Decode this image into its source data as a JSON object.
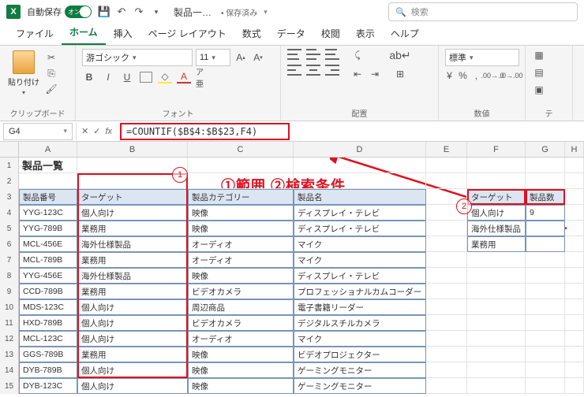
{
  "titlebar": {
    "autosave_label": "自動保存",
    "toggle_text": "オン",
    "doc_name": "製品一…",
    "saved_label": "• 保存済み",
    "search_placeholder": "検索"
  },
  "tabs": [
    "ファイル",
    "ホーム",
    "挿入",
    "ページ レイアウト",
    "数式",
    "データ",
    "校閲",
    "表示",
    "ヘルプ"
  ],
  "active_tab": 1,
  "ribbon": {
    "paste_label": "貼り付け",
    "clipboard_label": "クリップボード",
    "font_name": "游ゴシック",
    "font_size": "11",
    "font_label": "フォント",
    "align_label": "配置",
    "number_format": "標準",
    "number_label": "数値",
    "style_label": "テ"
  },
  "formula": {
    "cell_ref": "G4",
    "value": "=COUNTIF($B$4:$B$23,F4)"
  },
  "annotation_text": "①範囲 ②検索条件",
  "columns": [
    "A",
    "B",
    "C",
    "D",
    "E",
    "F",
    "G",
    "H"
  ],
  "title_text": "製品一覧",
  "table": {
    "headers": [
      "製品番号",
      "ターゲット",
      "製品カテゴリー",
      "製品名"
    ],
    "rows": [
      [
        "YYG-123C",
        "個人向け",
        "映像",
        "ディスプレイ・テレビ"
      ],
      [
        "YYG-789B",
        "業務用",
        "映像",
        "ディスプレイ・テレビ"
      ],
      [
        "MCL-456E",
        "海外仕様製品",
        "オーディオ",
        "マイク"
      ],
      [
        "MCL-789B",
        "業務用",
        "オーディオ",
        "マイク"
      ],
      [
        "YYG-456E",
        "海外仕様製品",
        "映像",
        "ディスプレイ・テレビ"
      ],
      [
        "CCD-789B",
        "業務用",
        "ビデオカメラ",
        "プロフェッショナルカムコーダー"
      ],
      [
        "MDS-123C",
        "個人向け",
        "周辺商品",
        "電子書籍リーダー"
      ],
      [
        "HXD-789B",
        "個人向け",
        "ビデオカメラ",
        "デジタルスチルカメラ"
      ],
      [
        "MCL-123C",
        "個人向け",
        "オーディオ",
        "マイク"
      ],
      [
        "GGS-789B",
        "業務用",
        "映像",
        "ビデオプロジェクター"
      ],
      [
        "DYB-789B",
        "個人向け",
        "映像",
        "ゲーミングモニター"
      ],
      [
        "DYB-123C",
        "個人向け",
        "映像",
        "ゲーミングモニター"
      ]
    ]
  },
  "side_table": {
    "headers": [
      "ターゲット",
      "製品数"
    ],
    "rows": [
      [
        "個人向け",
        "9"
      ],
      [
        "海外仕様製品",
        ""
      ],
      [
        "業務用",
        ""
      ]
    ]
  }
}
